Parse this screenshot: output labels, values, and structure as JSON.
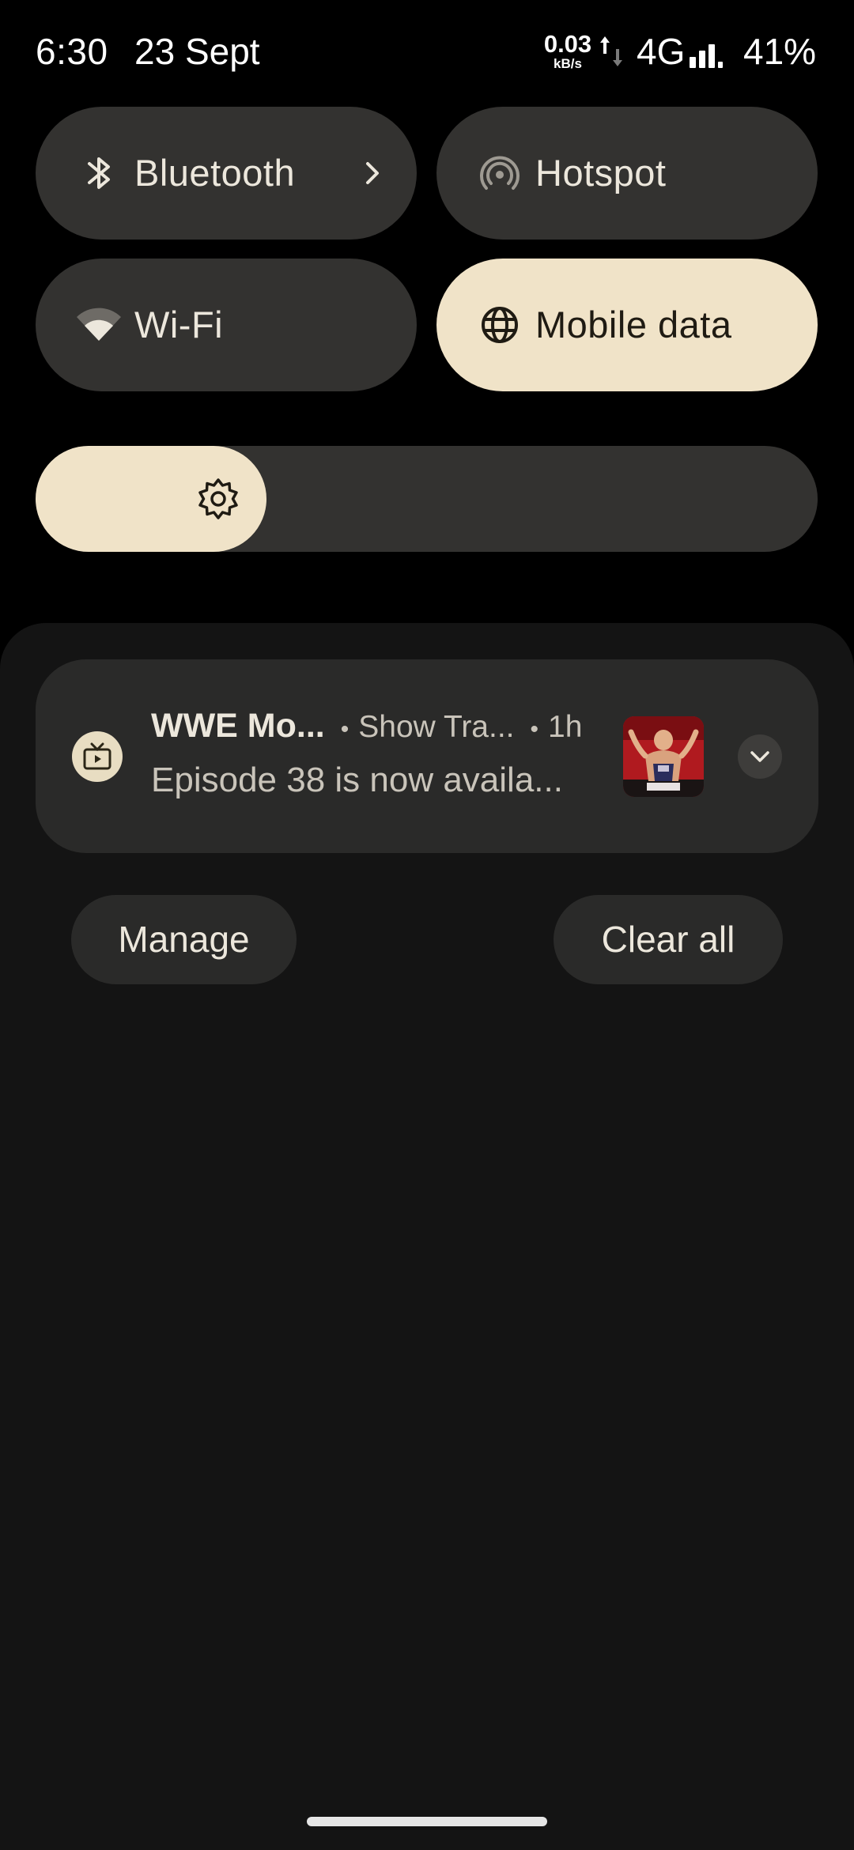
{
  "status_bar": {
    "time": "6:30",
    "date": "23 Sept",
    "net_speed_value": "0.03",
    "net_speed_unit": "kB/s",
    "network_type": "4G",
    "battery": "41%"
  },
  "quick_settings": {
    "tiles": [
      {
        "label": "Bluetooth",
        "icon": "bluetooth-icon",
        "active": false,
        "has_chevron": true
      },
      {
        "label": "Hotspot",
        "icon": "hotspot-icon",
        "active": false
      },
      {
        "label": "Wi-Fi",
        "icon": "wifi-icon",
        "active": false
      },
      {
        "label": "Mobile data",
        "icon": "globe-icon",
        "active": true
      }
    ],
    "brightness_level": 0.295
  },
  "notification": {
    "app_name": "WWE Mo...",
    "channel": "Show Tra...",
    "time_ago": "1h",
    "body": "Episode 38 is now availa...",
    "separator": "•",
    "app_icon": "tv-icon",
    "thumbnail": "wrestler-thumbnail"
  },
  "actions": {
    "manage_label": "Manage",
    "clear_all_label": "Clear all"
  },
  "colors": {
    "background": "#000000",
    "tile_inactive": "#333230",
    "tile_active": "#F0E3C8",
    "shade": "#141414",
    "card": "#2A2A29",
    "text_primary": "#ECE7DC",
    "text_secondary": "#C9C4BA"
  }
}
